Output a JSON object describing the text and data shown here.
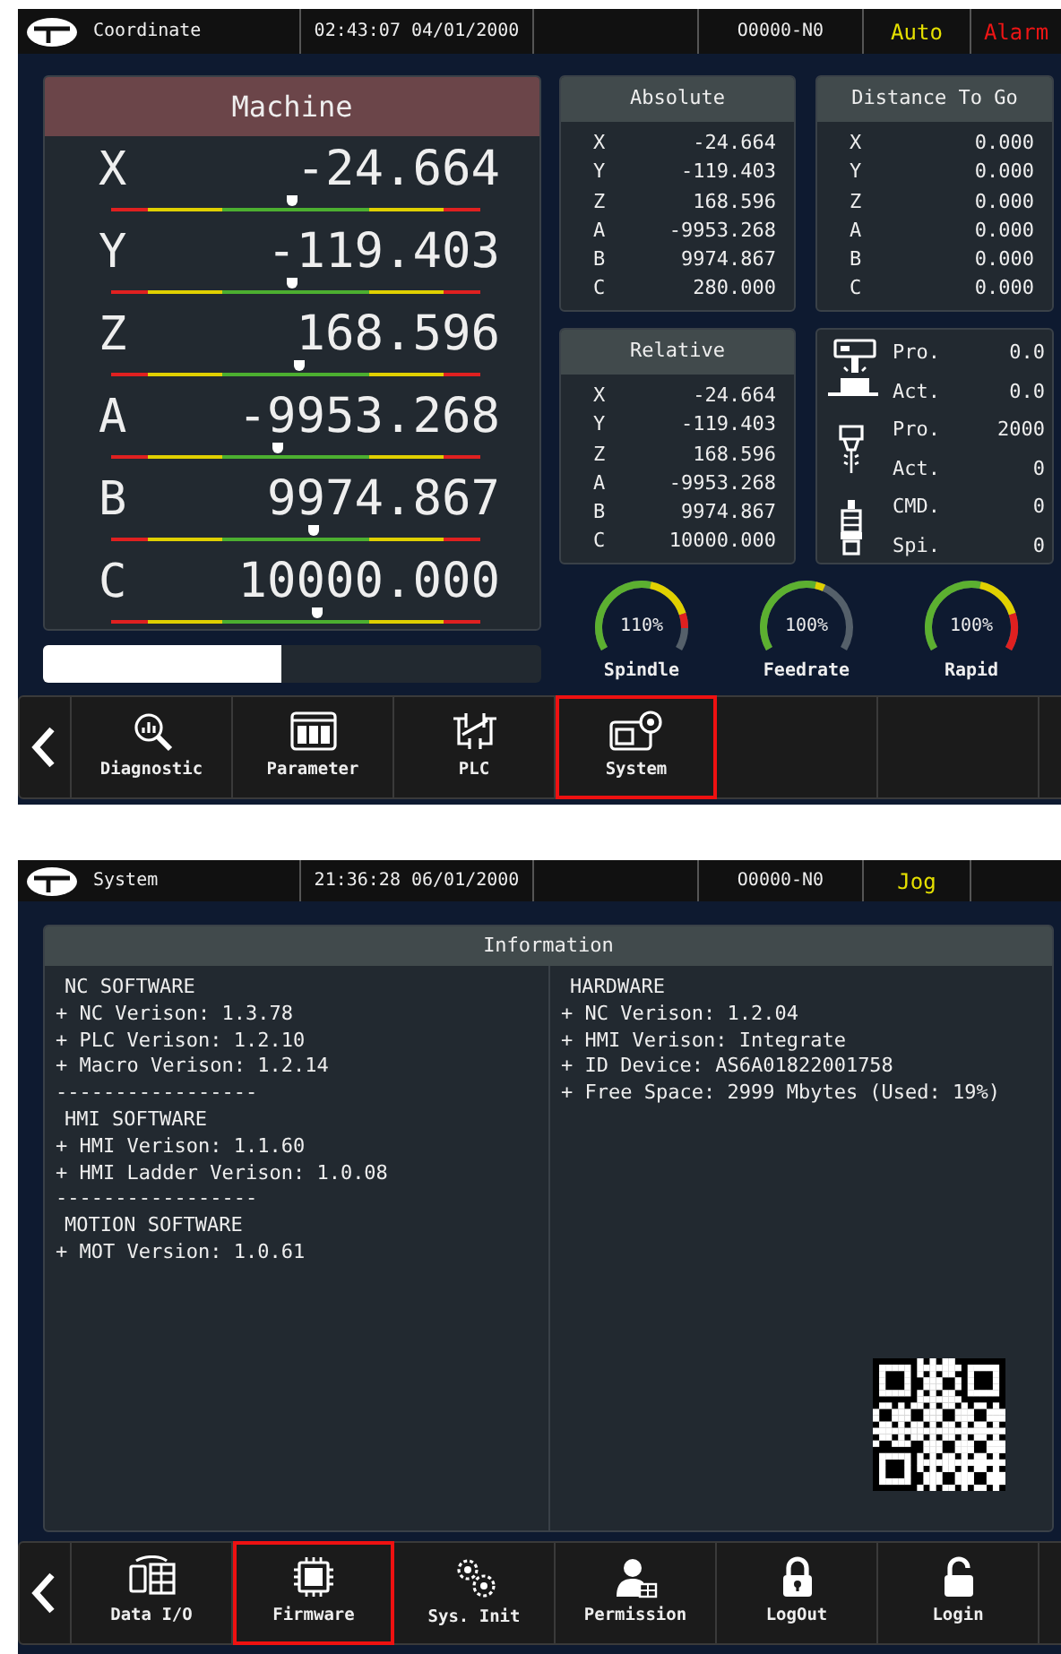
{
  "coordinate_screen": {
    "header": [
      {
        "kind": "title",
        "text": "Coordinate"
      },
      {
        "kind": "plain",
        "text": "02:43:07 04/01/2000"
      },
      {
        "kind": "blank"
      },
      {
        "kind": "plain",
        "text": "O0000-N0"
      },
      {
        "kind": "mode",
        "text": "Auto"
      },
      {
        "kind": "alarm",
        "text": "Alarm"
      }
    ],
    "machine": {
      "title": "Machine",
      "axes": [
        {
          "axis": "X",
          "value": "-24.664",
          "level": 0.49
        },
        {
          "axis": "Y",
          "value": "-119.403",
          "level": 0.49
        },
        {
          "axis": "Z",
          "value": "168.596",
          "level": 0.51
        },
        {
          "axis": "A",
          "value": "-9953.268",
          "level": 0.45
        },
        {
          "axis": "B",
          "value": "9974.867",
          "level": 0.55
        },
        {
          "axis": "C",
          "value": "10000.000",
          "level": 0.56
        }
      ]
    },
    "load_bar": {
      "level": 0.48
    },
    "absolute": {
      "title": "Absolute",
      "axes": [
        {
          "axis": "X",
          "value": "-24.664"
        },
        {
          "axis": "Y",
          "value": "-119.403"
        },
        {
          "axis": "Z",
          "value": "168.596"
        },
        {
          "axis": "A",
          "value": "-9953.268"
        },
        {
          "axis": "B",
          "value": "9974.867"
        },
        {
          "axis": "C",
          "value": "280.000"
        }
      ]
    },
    "distance_to_go": {
      "title": "Distance To Go",
      "axes": [
        {
          "axis": "X",
          "value": "0.000"
        },
        {
          "axis": "Y",
          "value": "0.000"
        },
        {
          "axis": "Z",
          "value": "0.000"
        },
        {
          "axis": "A",
          "value": "0.000"
        },
        {
          "axis": "B",
          "value": "0.000"
        },
        {
          "axis": "C",
          "value": "0.000"
        }
      ]
    },
    "relative": {
      "title": "Relative",
      "axes": [
        {
          "axis": "X",
          "value": "-24.664"
        },
        {
          "axis": "Y",
          "value": "-119.403"
        },
        {
          "axis": "Z",
          "value": "168.596"
        },
        {
          "axis": "A",
          "value": "-9953.268"
        },
        {
          "axis": "B",
          "value": "9974.867"
        },
        {
          "axis": "C",
          "value": "10000.000"
        }
      ]
    },
    "status": [
      {
        "kind": "machine",
        "rows": [
          {
            "label": "Pro.",
            "value": "0.0"
          },
          {
            "label": "Act.",
            "value": "0.0"
          }
        ]
      },
      {
        "kind": "tool",
        "rows": [
          {
            "label": "Pro.",
            "value": "2000"
          },
          {
            "label": "Act.",
            "value": "0"
          }
        ]
      },
      {
        "kind": "spindle",
        "rows": [
          {
            "label": "CMD.",
            "value": "0"
          },
          {
            "label": "Spi.",
            "value": "0"
          }
        ]
      }
    ],
    "gauges": [
      {
        "label": "Spindle",
        "reading": "110%"
      },
      {
        "label": "Feedrate",
        "reading": "100%"
      },
      {
        "label": "Rapid",
        "reading": "100%"
      }
    ],
    "toolbar": [
      {
        "kind": "back",
        "selected": false
      },
      {
        "kind": "diagnostic",
        "label": "Diagnostic",
        "selected": false
      },
      {
        "kind": "parameter",
        "label": "Parameter",
        "selected": false
      },
      {
        "kind": "plc",
        "label": "PLC",
        "selected": false
      },
      {
        "kind": "system",
        "label": "System",
        "selected": true
      },
      {
        "kind": "blank",
        "selected": false
      },
      {
        "kind": "blank",
        "selected": false
      },
      {
        "kind": "blank",
        "selected": false
      }
    ]
  },
  "system_screen": {
    "header": [
      {
        "kind": "title",
        "text": "System"
      },
      {
        "kind": "plain",
        "text": "21:36:28 06/01/2000"
      },
      {
        "kind": "blank"
      },
      {
        "kind": "plain",
        "text": "O0000-N0"
      },
      {
        "kind": "mode",
        "text": "Jog"
      },
      {
        "kind": "blank"
      }
    ],
    "information": {
      "title": "Information",
      "columns": [
        [
          {
            "kind": "heading",
            "text": "NC SOFTWARE"
          },
          {
            "kind": "item",
            "text": "+ NC Verison: 1.3.78"
          },
          {
            "kind": "item",
            "text": "+ PLC Verison: 1.2.10"
          },
          {
            "kind": "item",
            "text": "+ Macro Verison: 1.2.14"
          },
          {
            "kind": "separator",
            "text": "-----------------"
          },
          {
            "kind": "heading",
            "text": "HMI SOFTWARE"
          },
          {
            "kind": "item",
            "text": "+ HMI Verison: 1.1.60"
          },
          {
            "kind": "item",
            "text": "+ HMI Ladder Verison: 1.0.08"
          },
          {
            "kind": "separator",
            "text": "-----------------"
          },
          {
            "kind": "heading",
            "text": "MOTION SOFTWARE"
          },
          {
            "kind": "item",
            "text": "+ MOT Version: 1.0.61"
          }
        ],
        [
          {
            "kind": "heading",
            "text": "HARDWARE"
          },
          {
            "kind": "item",
            "text": "+ NC Verison: 1.2.04"
          },
          {
            "kind": "item",
            "text": "+ HMI Verison: Integrate"
          },
          {
            "kind": "item",
            "text": "+ ID Device: AS6A01822001758"
          },
          {
            "kind": "item",
            "text": "+ Free Space: 2999 Mbytes (Used: 19%)"
          }
        ]
      ]
    },
    "toolbar": [
      {
        "kind": "back",
        "selected": false
      },
      {
        "kind": "data-io",
        "label": "Data I/O",
        "selected": false
      },
      {
        "kind": "firmware",
        "label": "Firmware",
        "selected": true
      },
      {
        "kind": "sys-init",
        "label": "Sys. Init",
        "selected": false
      },
      {
        "kind": "permission",
        "label": "Permission",
        "selected": false
      },
      {
        "kind": "logout",
        "label": "LogOut",
        "selected": false
      },
      {
        "kind": "login",
        "label": "Login",
        "selected": false
      },
      {
        "kind": "blank",
        "selected": false
      }
    ]
  }
}
